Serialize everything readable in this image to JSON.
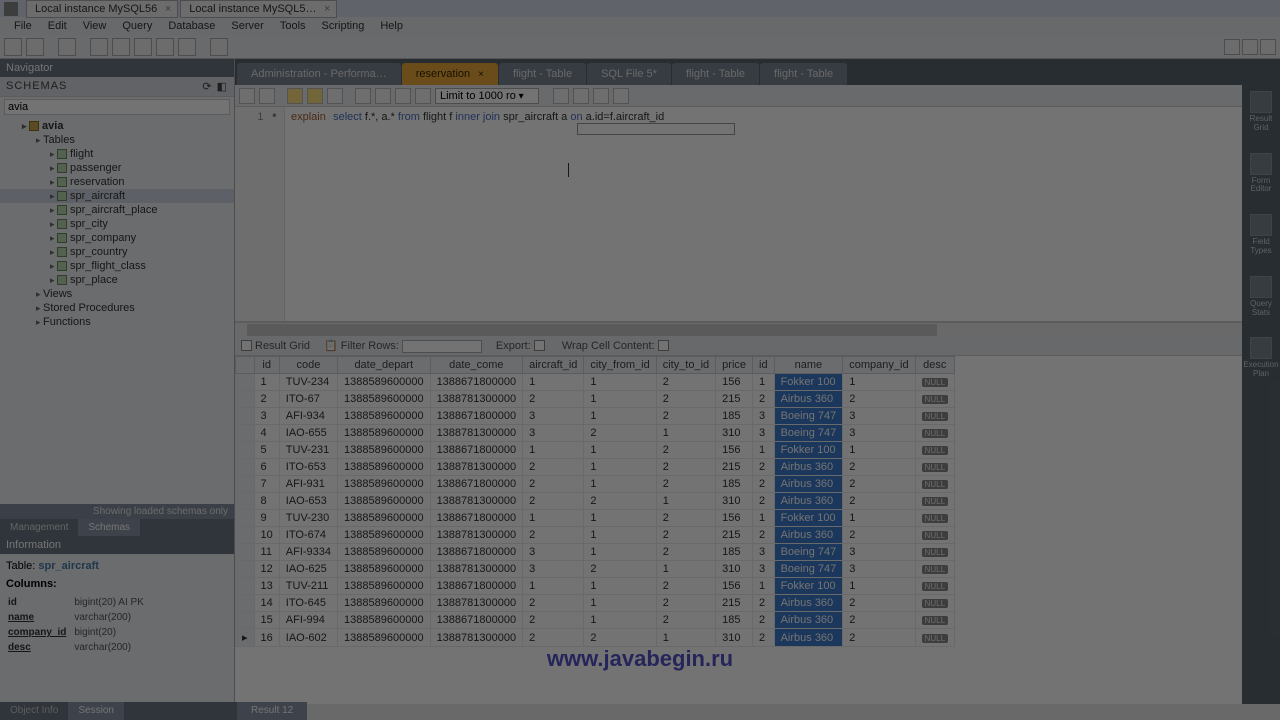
{
  "title_tabs": [
    "Local instance MySQL56",
    "Local instance MySQL5…"
  ],
  "menu": [
    "File",
    "Edit",
    "View",
    "Query",
    "Database",
    "Server",
    "Tools",
    "Scripting",
    "Help"
  ],
  "navigator": {
    "title": "Navigator",
    "schemas_label": "SCHEMAS",
    "search_value": "avia",
    "tree": {
      "db": "avia",
      "tables_label": "Tables",
      "tables": [
        "flight",
        "passenger",
        "reservation",
        "spr_aircraft",
        "spr_aircraft_place",
        "spr_city",
        "spr_company",
        "spr_country",
        "spr_flight_class",
        "spr_place"
      ],
      "views": "Views",
      "sp": "Stored Procedures",
      "fn": "Functions"
    },
    "loading_note": "Showing loaded schemas only",
    "side_tabs": [
      "Management",
      "Schemas"
    ],
    "info_title": "Information",
    "table_label": "Table:",
    "table_name": "spr_aircraft",
    "columns_label": "Columns:",
    "columns": [
      {
        "n": "id",
        "t": "bigint(20) AI PK"
      },
      {
        "n": "name",
        "t": "varchar(200)"
      },
      {
        "n": "company_id",
        "t": "bigint(20)"
      },
      {
        "n": "desc",
        "t": "varchar(200)"
      }
    ],
    "bottom_tabs": [
      "Object Info",
      "Session"
    ]
  },
  "editor_tabs": [
    {
      "label": "Administration - Performa…",
      "active": false
    },
    {
      "label": "reservation",
      "active": true
    },
    {
      "label": "flight - Table",
      "active": false
    },
    {
      "label": "SQL File 5*",
      "active": false
    },
    {
      "label": "flight - Table",
      "active": false
    },
    {
      "label": "flight - Table",
      "active": false
    }
  ],
  "query": {
    "limit_label": "Limit to 1000 ro",
    "line_no": "1",
    "sql": {
      "p1": "explain",
      "p2": "select",
      "p3": " f.*, a.* ",
      "p4": "from",
      "p5": " flight f ",
      "p6": "inner",
      "p7": " ",
      "p8": "join",
      "p9": " spr_aircraft a ",
      "p10": "on",
      "p11": " a.id=f.aircraft_id"
    }
  },
  "result_toolbar": {
    "result_grid": "Result Grid",
    "filter": "Filter Rows:",
    "export": "Export:",
    "wrap": "Wrap Cell Content:"
  },
  "right_side": [
    "Result\nGrid",
    "Form\nEditor",
    "Field\nTypes",
    "Query\nStats",
    "Execution\nPlan"
  ],
  "columns_header": [
    "",
    "id",
    "code",
    "date_depart",
    "date_come",
    "aircraft_id",
    "city_from_id",
    "city_to_id",
    "price",
    "id",
    "name",
    "company_id",
    "desc"
  ],
  "chart_data": {
    "type": "table",
    "columns": [
      "id",
      "code",
      "date_depart",
      "date_come",
      "aircraft_id",
      "city_from_id",
      "city_to_id",
      "price",
      "id",
      "name",
      "company_id",
      "desc"
    ],
    "rows": [
      [
        1,
        "TUV-234",
        "1388589600000",
        "1388671800000",
        1,
        1,
        2,
        156,
        1,
        "Fokker 100",
        1,
        "NULL"
      ],
      [
        2,
        "ITO-67",
        "1388589600000",
        "1388781300000",
        2,
        1,
        2,
        215,
        2,
        "Airbus 360",
        2,
        "NULL"
      ],
      [
        3,
        "AFI-934",
        "1388589600000",
        "1388671800000",
        3,
        1,
        2,
        185,
        3,
        "Boeing 747",
        3,
        "NULL"
      ],
      [
        4,
        "IAO-655",
        "1388589600000",
        "1388781300000",
        3,
        2,
        1,
        310,
        3,
        "Boeing 747",
        3,
        "NULL"
      ],
      [
        5,
        "TUV-231",
        "1388589600000",
        "1388671800000",
        1,
        1,
        2,
        156,
        1,
        "Fokker 100",
        1,
        "NULL"
      ],
      [
        6,
        "ITO-653",
        "1388589600000",
        "1388781300000",
        2,
        1,
        2,
        215,
        2,
        "Airbus 360",
        2,
        "NULL"
      ],
      [
        7,
        "AFI-931",
        "1388589600000",
        "1388671800000",
        2,
        1,
        2,
        185,
        2,
        "Airbus 360",
        2,
        "NULL"
      ],
      [
        8,
        "IAO-653",
        "1388589600000",
        "1388781300000",
        2,
        2,
        1,
        310,
        2,
        "Airbus 360",
        2,
        "NULL"
      ],
      [
        9,
        "TUV-230",
        "1388589600000",
        "1388671800000",
        1,
        1,
        2,
        156,
        1,
        "Fokker 100",
        1,
        "NULL"
      ],
      [
        10,
        "ITO-674",
        "1388589600000",
        "1388781300000",
        2,
        1,
        2,
        215,
        2,
        "Airbus 360",
        2,
        "NULL"
      ],
      [
        11,
        "AFI-9334",
        "1388589600000",
        "1388671800000",
        3,
        1,
        2,
        185,
        3,
        "Boeing 747",
        3,
        "NULL"
      ],
      [
        12,
        "IAO-625",
        "1388589600000",
        "1388781300000",
        3,
        2,
        1,
        310,
        3,
        "Boeing 747",
        3,
        "NULL"
      ],
      [
        13,
        "TUV-211",
        "1388589600000",
        "1388671800000",
        1,
        1,
        2,
        156,
        1,
        "Fokker 100",
        1,
        "NULL"
      ],
      [
        14,
        "ITO-645",
        "1388589600000",
        "1388781300000",
        2,
        1,
        2,
        215,
        2,
        "Airbus 360",
        2,
        "NULL"
      ],
      [
        15,
        "AFI-994",
        "1388589600000",
        "1388671800000",
        2,
        1,
        2,
        185,
        2,
        "Airbus 360",
        2,
        "NULL"
      ],
      [
        16,
        "IAO-602",
        "1388589600000",
        "1388781300000",
        2,
        2,
        1,
        310,
        2,
        "Airbus 360",
        2,
        "NULL"
      ]
    ]
  },
  "watermark": "www.javabegin.ru",
  "bottom_result_tab": "Result 12"
}
